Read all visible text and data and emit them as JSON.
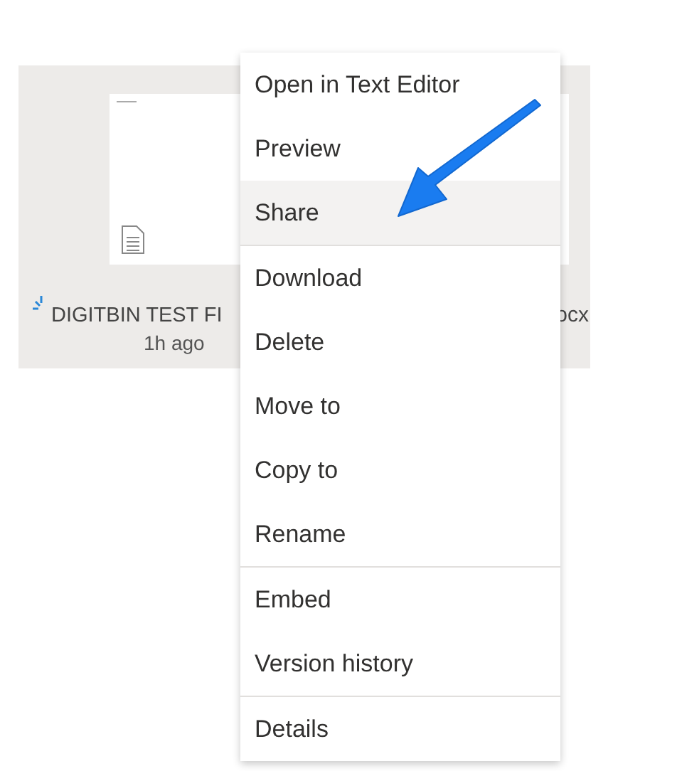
{
  "file_tile": {
    "name": "DIGITBIN TEST FI",
    "name_tail": "ocx",
    "modified": "1h ago",
    "syncing": true
  },
  "context_menu": {
    "groups": [
      [
        {
          "label": "Open in Text Editor",
          "selected": false
        },
        {
          "label": "Preview",
          "selected": false
        },
        {
          "label": "Share",
          "selected": true
        }
      ],
      [
        {
          "label": "Download",
          "selected": false
        },
        {
          "label": "Delete",
          "selected": false
        },
        {
          "label": "Move to",
          "selected": false
        },
        {
          "label": "Copy to",
          "selected": false
        },
        {
          "label": "Rename",
          "selected": false
        }
      ],
      [
        {
          "label": "Embed",
          "selected": false
        },
        {
          "label": "Version history",
          "selected": false
        }
      ],
      [
        {
          "label": "Details",
          "selected": false
        }
      ]
    ]
  }
}
